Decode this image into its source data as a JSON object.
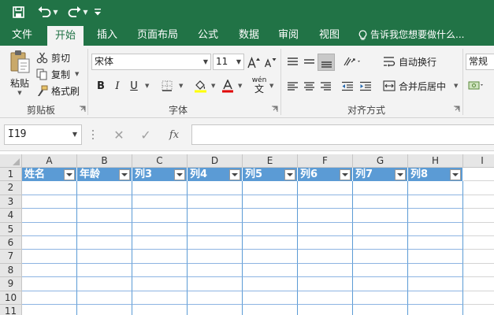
{
  "window": {
    "quick_access": {
      "save_icon": "save-icon",
      "undo_icon": "undo-icon",
      "redo_icon": "redo-icon",
      "customize_icon": "customize-icon"
    }
  },
  "tabs": [
    {
      "label": "文件",
      "active": false
    },
    {
      "label": "开始",
      "active": true
    },
    {
      "label": "插入",
      "active": false
    },
    {
      "label": "页面布局",
      "active": false
    },
    {
      "label": "公式",
      "active": false
    },
    {
      "label": "数据",
      "active": false
    },
    {
      "label": "审阅",
      "active": false
    },
    {
      "label": "视图",
      "active": false
    }
  ],
  "tell_me": "告诉我您想要做什么...",
  "ribbon": {
    "clipboard": {
      "paste": "粘贴",
      "cut": "剪切",
      "copy": "复制",
      "format_painter": "格式刷",
      "label": "剪贴板"
    },
    "font": {
      "name": "宋体",
      "size": "11",
      "bold": "B",
      "italic": "I",
      "underline": "U",
      "phonetic": "wén",
      "label": "字体"
    },
    "alignment": {
      "wrap_text": "自动换行",
      "merge_center": "合并后居中",
      "label": "对齐方式"
    },
    "number": {
      "format": "常规"
    }
  },
  "formula_bar": {
    "name_box": "I19",
    "cancel": "✕",
    "enter": "✓",
    "fx": "fx",
    "value": ""
  },
  "sheet": {
    "columns": [
      "A",
      "B",
      "C",
      "D",
      "E",
      "F",
      "G",
      "H",
      "I"
    ],
    "rows": [
      "1",
      "2",
      "3",
      "4",
      "5",
      "6",
      "7",
      "8",
      "9",
      "10",
      "11"
    ],
    "table_headers": [
      "姓名",
      "年龄",
      "列3",
      "列4",
      "列5",
      "列6",
      "列7",
      "列8"
    ]
  },
  "colors": {
    "excel_green": "#217346",
    "table_header_blue": "#5b9bd5",
    "table_border_blue": "#8db4e2"
  }
}
